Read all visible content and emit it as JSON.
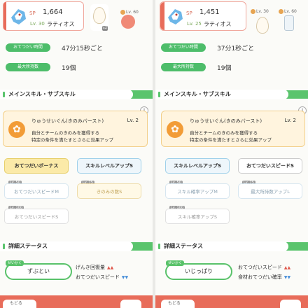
{
  "left": {
    "pokemon": {
      "sp_label": "SP",
      "sp_value": "1,664",
      "level": "Lv. 30",
      "name": "ラティオス"
    },
    "header_items": {
      "item_count": "x2",
      "lv60": "Lv. 60"
    },
    "stats": [
      {
        "label": "おてつだい時間",
        "value": "47分15秒ごと"
      },
      {
        "label": "最大所持数",
        "value": "19個"
      }
    ],
    "section_skill": "メインスキル・サブスキル",
    "main_skill": {
      "name": "りゅうせいぐん(きのみバースト)",
      "level": "Lv. 2",
      "desc_line1": "自分とチームのきのみを獲得する",
      "desc_line2": "特定の条件を満たすとさらに効果アップ"
    },
    "sub_skills": [
      {
        "label": "おてつだいボーナス",
        "lv": ""
      },
      {
        "label": "スキルレベルアップS",
        "lv": ""
      },
      {
        "label": "おてつだいスピードM",
        "lv": "Lv. 50"
      },
      {
        "label": "きのみの数S",
        "lv": "Lv. 75"
      },
      {
        "label": "おてつだいスピードS",
        "lv": "Lv. 100"
      }
    ],
    "section_detail": "詳細ステータス",
    "nature": {
      "tag": "せいかく",
      "name": "ずぶとい"
    },
    "effects": [
      {
        "label": "げんき回復量",
        "dir": "up"
      },
      {
        "label": "おてつだいスピード",
        "dir": "down"
      }
    ],
    "bottom_label": "もどる"
  },
  "right": {
    "pokemon": {
      "sp_label": "SP",
      "sp_value": "1,451",
      "level": "Lv. 25",
      "name": "ラティオス"
    },
    "header_items": {
      "lv30": "Lv. 30",
      "lv60": "Lv. 60"
    },
    "stats": [
      {
        "label": "おてつだい時間",
        "value": "37分1秒ごと"
      },
      {
        "label": "最大所持数",
        "value": "19個"
      }
    ],
    "section_skill": "メインスキル・サブスキル",
    "main_skill": {
      "name": "りゅうせいぐん(きのみバースト)",
      "level": "Lv. 2",
      "desc_line1": "自分とチームのきのみを獲得する",
      "desc_line2": "特定の条件を満たすとさらに効果アップ"
    },
    "sub_skills": [
      {
        "label": "スキルレベルアップS",
        "lv": ""
      },
      {
        "label": "おてつだいスピードS",
        "lv": ""
      },
      {
        "label": "スキル確率アップM",
        "lv": "Lv. 50"
      },
      {
        "label": "最大所持数アップL",
        "lv": "Lv. 75"
      },
      {
        "label": "スキル確率アップS",
        "lv": "Lv. 100"
      }
    ],
    "section_detail": "詳細ステータス",
    "nature": {
      "tag": "せいかく",
      "name": "いじっぱり"
    },
    "effects": [
      {
        "label": "おてつだいスピード",
        "dir": "up"
      },
      {
        "label": "食材おてつだい確率",
        "dir": "down"
      }
    ],
    "bottom_label": "もどる"
  },
  "colors": {
    "accent": "#5ac46d",
    "brand": "#e86c5a",
    "skill_bg": "#fff4de",
    "up": "#e0574b",
    "down": "#4a90d9"
  },
  "icons": {
    "skill": "berry-burst-icon",
    "info": "info-icon"
  }
}
